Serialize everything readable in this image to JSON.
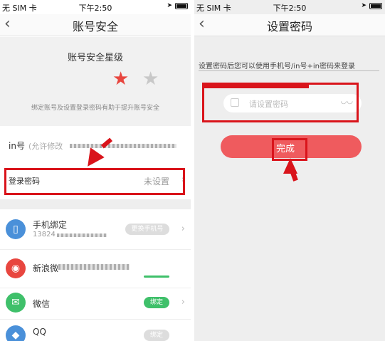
{
  "status": {
    "carrier": "无 SIM 卡",
    "time": "下午2:50"
  },
  "left": {
    "nav_title": "账号安全",
    "star_title": "账号安全星级",
    "star_tip": "绑定账号及设置登录密码有助于提升账号安全",
    "inid": {
      "label": "in号",
      "hint": "(允许修改"
    },
    "password": {
      "label": "登录密码",
      "value": "未设置"
    },
    "phone": {
      "label": "手机绑定",
      "number": "13824",
      "tag": "更换手机号"
    },
    "weibo": {
      "label": "新浪微"
    },
    "wechat": {
      "label": "微信",
      "tag": "绑定"
    },
    "qq": {
      "label": "QQ",
      "tag": "绑定"
    }
  },
  "right": {
    "nav_title": "设置密码",
    "hint": "设置密码后您可以使用手机号/in号+in密码来登录",
    "placeholder": "请设置密码",
    "done": "完成"
  },
  "colors": {
    "accent_red": "#d9141b",
    "star_red": "#e8463f",
    "star_gray": "#c8c8c8",
    "green": "#3fc06a",
    "button_red": "#ef5b5e"
  },
  "icons": [
    "back-icon",
    "star-icon",
    "chevron-right-icon",
    "phone-icon",
    "weibo-icon",
    "wechat-icon",
    "qq-icon",
    "lock-icon",
    "eye-icon",
    "wifi-icon",
    "battery-icon",
    "location-icon"
  ]
}
